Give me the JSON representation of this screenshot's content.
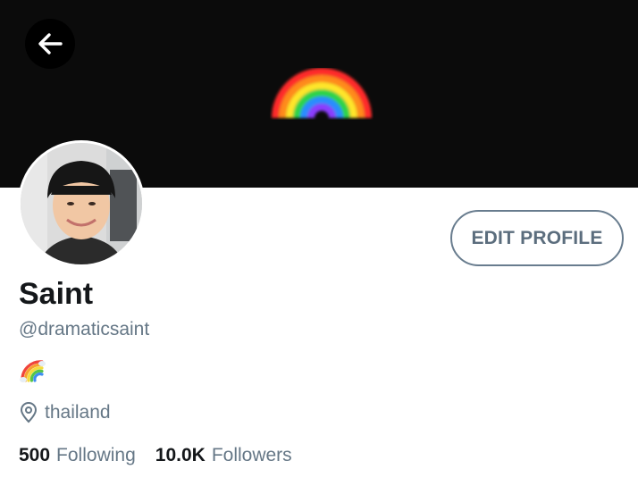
{
  "profile": {
    "display_name": "Saint",
    "handle": "@dramaticsaint",
    "bio_icon": "rainbow-emoji",
    "location": "thailand",
    "edit_button_label": "EDIT PROFILE"
  },
  "stats": {
    "following_count": "500",
    "following_label": "Following",
    "followers_count": "10.0K",
    "followers_label": "Followers"
  },
  "icons": {
    "back": "back-arrow-icon",
    "location": "location-pin-icon"
  },
  "colors": {
    "banner_bg": "#0b0b0b",
    "text_primary": "#14171a",
    "text_secondary": "#657786",
    "button_border": "#687c8e"
  }
}
